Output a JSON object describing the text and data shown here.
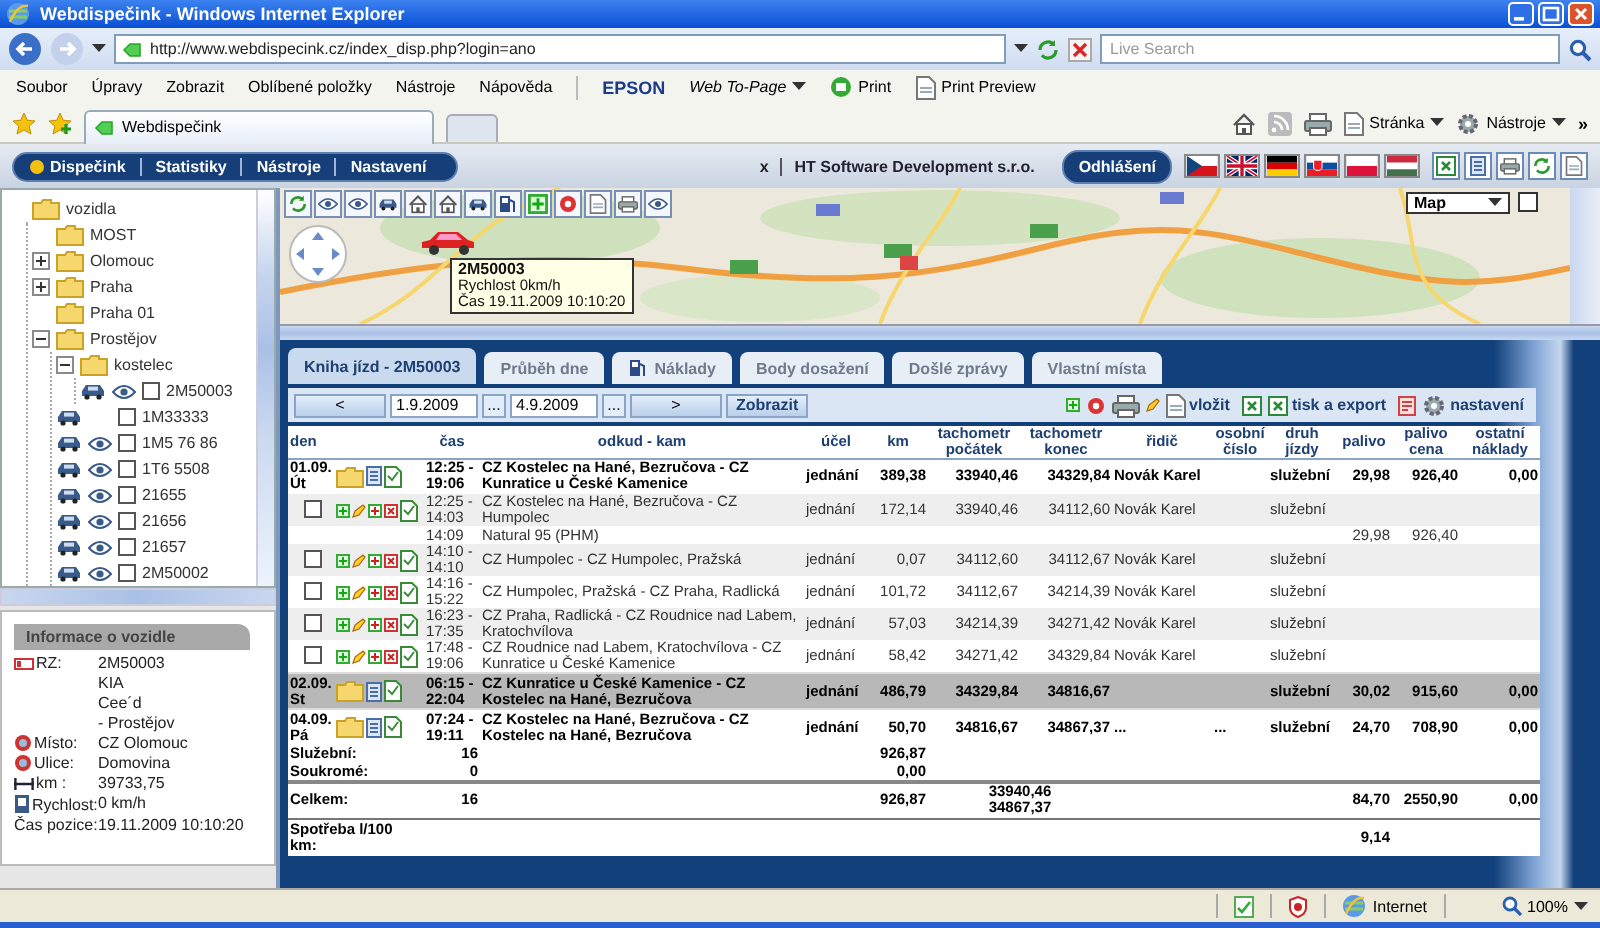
{
  "window": {
    "title": "Webdispečink - Windows Internet Explorer"
  },
  "browser": {
    "url": "http://www.webdispecink.cz/index_disp.php?login=ano",
    "search_placeholder": "Live Search",
    "menu": [
      "Soubor",
      "Úpravy",
      "Zobrazit",
      "Oblíbené položky",
      "Nástroje",
      "Nápověda"
    ],
    "toolbar": [
      {
        "kind": "brand",
        "label": "EPSON"
      },
      {
        "kind": "dropdown",
        "label": "Web To-Page"
      },
      {
        "kind": "print",
        "label": "Print"
      },
      {
        "kind": "preview",
        "label": "Print Preview"
      }
    ],
    "tab": "Webdispečink",
    "commands": [
      {
        "kind": "page",
        "label": "Stránka"
      },
      {
        "kind": "tools",
        "label": "Nástroje"
      }
    ],
    "overflow": "»"
  },
  "app_nav": {
    "items": [
      {
        "label": "Dispečink",
        "selected": true
      },
      {
        "label": "Statistiky",
        "selected": false
      },
      {
        "label": "Nástroje",
        "selected": false
      },
      {
        "label": "Nastavení",
        "selected": false
      }
    ],
    "close": "x",
    "company": "HT Software Development s.r.o.",
    "logout": "Odhlášení",
    "languages": [
      {
        "kind": "cz"
      },
      {
        "kind": "gb"
      },
      {
        "kind": "de"
      },
      {
        "kind": "sk"
      },
      {
        "kind": "pl"
      },
      {
        "kind": "hu"
      }
    ]
  },
  "tree": {
    "label": "vozidla",
    "children": [
      {
        "label": "MOST"
      },
      {
        "label": "Olomouc",
        "expanded": false
      },
      {
        "label": "Praha",
        "expanded": false
      },
      {
        "label": "Praha 01"
      },
      {
        "label": "Prostějov",
        "expanded": true,
        "children": [
          {
            "label": "kostelec",
            "expanded": true,
            "children": [
              {
                "kind": "vehicle",
                "label": "2M50003",
                "visible": true,
                "checked": false
              }
            ]
          },
          {
            "kind": "vehicle",
            "label": "1M33333",
            "visible": false,
            "checked": false
          },
          {
            "kind": "vehicle",
            "label": "1M5 76 86",
            "visible": true,
            "checked": false
          },
          {
            "kind": "vehicle",
            "label": "1T6 5508",
            "visible": true,
            "checked": false
          },
          {
            "kind": "vehicle",
            "label": "21655",
            "visible": true,
            "checked": false
          },
          {
            "kind": "vehicle",
            "label": "21656",
            "visible": true,
            "checked": false
          },
          {
            "kind": "vehicle",
            "label": "21657",
            "visible": true,
            "checked": false
          },
          {
            "kind": "vehicle",
            "label": "2M50002",
            "visible": true,
            "checked": false
          }
        ]
      }
    ]
  },
  "vehicle_info": {
    "title": "Informace o vozidle",
    "rows": [
      {
        "kind": "plate",
        "label": "RZ:",
        "value": "2M50003"
      },
      {
        "value": "KIA"
      },
      {
        "value": "Cee´d"
      },
      {
        "value": "- Prostějov"
      },
      {
        "kind": "place",
        "label": "Místo:",
        "value": "CZ Olomouc"
      },
      {
        "kind": "place",
        "label": "Ulice:",
        "value": "Domovina"
      },
      {
        "kind": "distance",
        "label": "km :",
        "value": "39733,75"
      },
      {
        "kind": "speed",
        "label": "Rychlost:",
        "value": "0 km/h"
      },
      {
        "label": "Čas pozice:",
        "value": "19.11.2009 10:10:20"
      }
    ]
  },
  "map": {
    "kind": "picture",
    "type_select": "Map",
    "marker": {
      "title": "2M50003",
      "lines": [
        "Rychlost 0km/h",
        "Čas 19.11.2009 10:10:20"
      ]
    }
  },
  "tabs": [
    {
      "label": "Kniha jízd - 2M50003",
      "selected": true
    },
    {
      "label": "Průběh dne",
      "selected": false
    },
    {
      "label": "Náklady",
      "selected": false,
      "kind": "fuel"
    },
    {
      "label": "Body dosažení",
      "selected": false
    },
    {
      "label": "Došlé zprávy",
      "selected": false
    },
    {
      "label": "Vlastní místa",
      "selected": false
    }
  ],
  "filter": {
    "prev": "<",
    "from": "1.9.2009",
    "from_picker": "...",
    "to": "4.9.2009",
    "to_picker": "...",
    "next": ">",
    "submit": "Zobrazit"
  },
  "actions": [
    {
      "kind": "insert",
      "label": "vložit"
    },
    {
      "kind": "export",
      "label": "tisk a export"
    },
    {
      "kind": "settings",
      "label": "nastavení"
    }
  ],
  "table": {
    "columns": [
      "den",
      "čas",
      "odkud - kam",
      "účel",
      "km",
      "tachometr počátek",
      "tachometr konec",
      "řidič",
      "osobní číslo",
      "druh jízdy",
      "palivo",
      "palivo cena",
      "ostatní náklady"
    ],
    "rows": [
      {
        "kind": "day",
        "date": "01.09. Út",
        "time": "12:25 - 19:06",
        "route": "CZ Kostelec na Hané, Bezručova - CZ Kunratice u České Kamenice",
        "purpose": "jednání",
        "km": "389,38",
        "odo_start": "33940,46",
        "odo_end": "34329,84",
        "driver": "Novák Karel",
        "trip_type": "služební",
        "fuel": "29,98",
        "fuel_cost": "926,40",
        "other_costs": "0,00",
        "selected": false
      },
      {
        "kind": "trip",
        "checked": false,
        "time": "12:25 - 14:03",
        "route": "CZ Kostelec na Hané, Bezručova - CZ Humpolec",
        "purpose": "jednání",
        "km": "172,14",
        "odo_start": "33940,46",
        "odo_end": "34112,60",
        "driver": "Novák Karel",
        "trip_type": "služební"
      },
      {
        "kind": "fuel",
        "time": "14:09",
        "route": "Natural 95 (PHM)",
        "fuel": "29,98",
        "fuel_cost": "926,40"
      },
      {
        "kind": "trip",
        "checked": false,
        "time": "14:10 - 14:10",
        "route": "CZ Humpolec - CZ Humpolec, Pražská",
        "purpose": "jednání",
        "km": "0,07",
        "odo_start": "34112,60",
        "odo_end": "34112,67",
        "driver": "Novák Karel",
        "trip_type": "služební"
      },
      {
        "kind": "trip",
        "checked": false,
        "time": "14:16 - 15:22",
        "route": "CZ Humpolec, Pražská - CZ Praha, Radlická",
        "purpose": "jednání",
        "km": "101,72",
        "odo_start": "34112,67",
        "odo_end": "34214,39",
        "driver": "Novák Karel",
        "trip_type": "služební"
      },
      {
        "kind": "trip",
        "checked": false,
        "time": "16:23 - 17:35",
        "route": "CZ Praha, Radlická - CZ Roudnice nad Labem, Kratochvílova",
        "purpose": "jednání",
        "km": "57,03",
        "odo_start": "34214,39",
        "odo_end": "34271,42",
        "driver": "Novák Karel",
        "trip_type": "služební"
      },
      {
        "kind": "trip",
        "checked": false,
        "time": "17:48 - 19:06",
        "route": "CZ Roudnice nad Labem, Kratochvílova - CZ Kunratice u České Kamenice",
        "purpose": "jednání",
        "km": "58,42",
        "odo_start": "34271,42",
        "odo_end": "34329,84",
        "driver": "Novák Karel",
        "trip_type": "služební"
      },
      {
        "kind": "day",
        "date": "02.09. St",
        "time": "06:15 - 22:04",
        "route": "CZ Kunratice u České Kamenice - CZ Kostelec na Hané, Bezručova",
        "purpose": "jednání",
        "km": "486,79",
        "odo_start": "34329,84",
        "odo_end": "34816,67",
        "trip_type": "služební",
        "fuel": "30,02",
        "fuel_cost": "915,60",
        "other_costs": "0,00",
        "selected": true
      },
      {
        "kind": "day",
        "date": "04.09. Pá",
        "time": "07:24 - 19:11",
        "route": "CZ Kostelec na Hané, Bezručova - CZ Kostelec na Hané, Bezručova",
        "purpose": "jednání",
        "km": "50,70",
        "odo_start": "34816,67",
        "odo_end": "34867,37",
        "driver": "...",
        "personal_no": "...",
        "trip_type": "služební",
        "fuel": "24,70",
        "fuel_cost": "708,90",
        "other_costs": "0,00",
        "selected": false
      }
    ],
    "summary": [
      {
        "kind": "split",
        "label": "Služební:",
        "count": "16",
        "km": "926,87"
      },
      {
        "kind": "split",
        "label": "Soukromé:",
        "count": "0",
        "km": "0,00"
      },
      {
        "kind": "total",
        "label": "Celkem:",
        "count": "16",
        "km": "926,87",
        "odo_start": "33940,46",
        "odo_end": "34867,37",
        "fuel": "84,70",
        "fuel_cost": "2550,90",
        "other_costs": "0,00"
      },
      {
        "kind": "consumption",
        "label": "Spotřeba l/100 km:",
        "fuel": "9,14"
      }
    ]
  },
  "status_bar": {
    "zone": "Internet",
    "zoom": "100%"
  }
}
